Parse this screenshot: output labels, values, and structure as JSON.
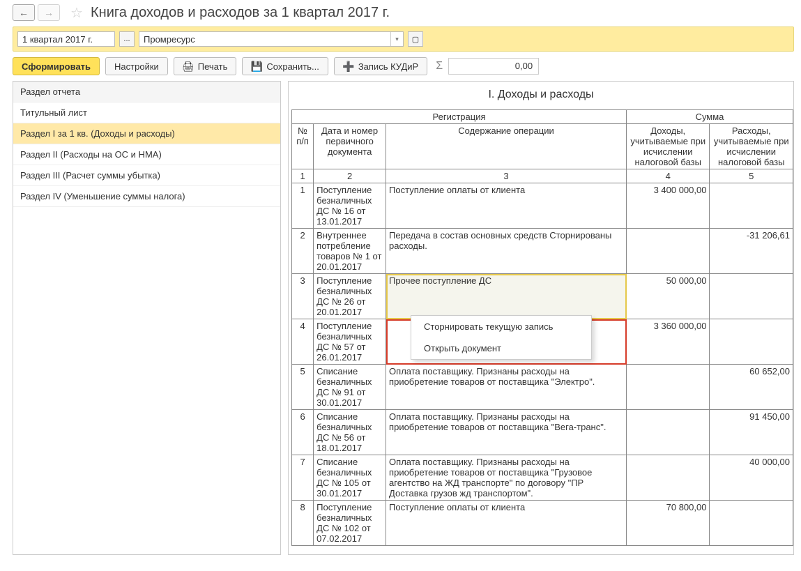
{
  "header": {
    "title": "Книга доходов и расходов за 1 квартал 2017 г."
  },
  "filter": {
    "period": "1 квартал 2017 г.",
    "org": "Промресурс"
  },
  "toolbar": {
    "form": "Сформировать",
    "settings": "Настройки",
    "print": "Печать",
    "save": "Сохранить...",
    "kudir": "Запись КУДиР",
    "sum": "0,00"
  },
  "sidebar": {
    "header": "Раздел отчета",
    "items": [
      "Титульный лист",
      "Раздел I за 1 кв. (Доходы и расходы)",
      "Раздел II (Расходы на ОС и НМА)",
      "Раздел III (Расчет суммы убытка)",
      "Раздел IV (Уменьшение суммы налога)"
    ],
    "selected_index": 1
  },
  "report": {
    "section_title": "I. Доходы и расходы",
    "headers": {
      "reg": "Регистрация",
      "sum": "Сумма",
      "num": "№ п/п",
      "doc": "Дата и номер первичного документа",
      "op": "Содержание операции",
      "inc": "Доходы, учитываемые при исчислении налоговой базы",
      "exp": "Расходы, учитываемые при исчислении налоговой базы"
    },
    "colnums": [
      "1",
      "2",
      "3",
      "4",
      "5"
    ],
    "rows": [
      {
        "n": "1",
        "doc": "Поступление безналичных ДС № 16 от 13.01.2017",
        "op": "Поступление оплаты от клиента",
        "inc": "3 400 000,00",
        "exp": ""
      },
      {
        "n": "2",
        "doc": "Внутреннее потребление товаров № 1 от 20.01.2017",
        "op": "Передача в состав основных средств Сторнированы расходы.",
        "inc": "",
        "exp": "-31 206,61"
      },
      {
        "n": "3",
        "doc": "Поступление безналичных ДС № 26 от 20.01.2017",
        "op": "Прочее поступление ДС",
        "inc": "50 000,00",
        "exp": ""
      },
      {
        "n": "4",
        "doc": "Поступление безналичных ДС № 57 от 26.01.2017",
        "op": "",
        "inc": "3 360 000,00",
        "exp": ""
      },
      {
        "n": "5",
        "doc": "Списание безналичных ДС № 91 от 30.01.2017",
        "op": "Оплата поставщику. Признаны расходы на приобретение товаров от поставщика \"Электро\".",
        "inc": "",
        "exp": "60 652,00"
      },
      {
        "n": "6",
        "doc": "Списание безналичных ДС № 56 от 18.01.2017",
        "op": "Оплата поставщику. Признаны расходы на приобретение товаров от поставщика \"Вега-транс\".",
        "inc": "",
        "exp": "91 450,00"
      },
      {
        "n": "7",
        "doc": "Списание безналичных ДС № 105 от 30.01.2017",
        "op": "Оплата поставщику. Признаны расходы на приобретение товаров от поставщика \"Грузовое агентство на ЖД транспорте\" по договору \"ПР Доставка грузов жд транспортом\".",
        "inc": "",
        "exp": "40 000,00"
      },
      {
        "n": "8",
        "doc": "Поступление безналичных ДС № 102 от 07.02.2017",
        "op": "Поступление оплаты от клиента",
        "inc": "70 800,00",
        "exp": ""
      }
    ]
  },
  "context_menu": {
    "items": [
      "Сторнировать текущую запись",
      "Открыть документ"
    ]
  }
}
